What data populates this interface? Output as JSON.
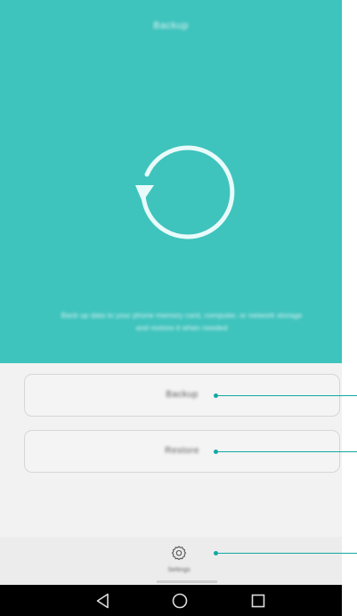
{
  "colors": {
    "accent": "#3fc3bd",
    "panel": "#f2f2f2",
    "bottom_bar": "#ececec",
    "button_bg": "#f4f4f4",
    "callout": "#12a9a2",
    "navbar": "#000000"
  },
  "header": {
    "title": "Backup"
  },
  "hero": {
    "icon": "refresh-icon",
    "description_line1": "Back up data to your phone memory card, computer, or network storage",
    "description_line2": "and restore it when needed"
  },
  "actions": {
    "backup_label": "Backup",
    "restore_label": "Restore"
  },
  "bottom_tab": {
    "icon": "gear-icon",
    "label": "Settings"
  },
  "navbar": {
    "back_icon": "back-triangle-icon",
    "home_icon": "home-circle-icon",
    "recents_icon": "recents-square-icon"
  }
}
